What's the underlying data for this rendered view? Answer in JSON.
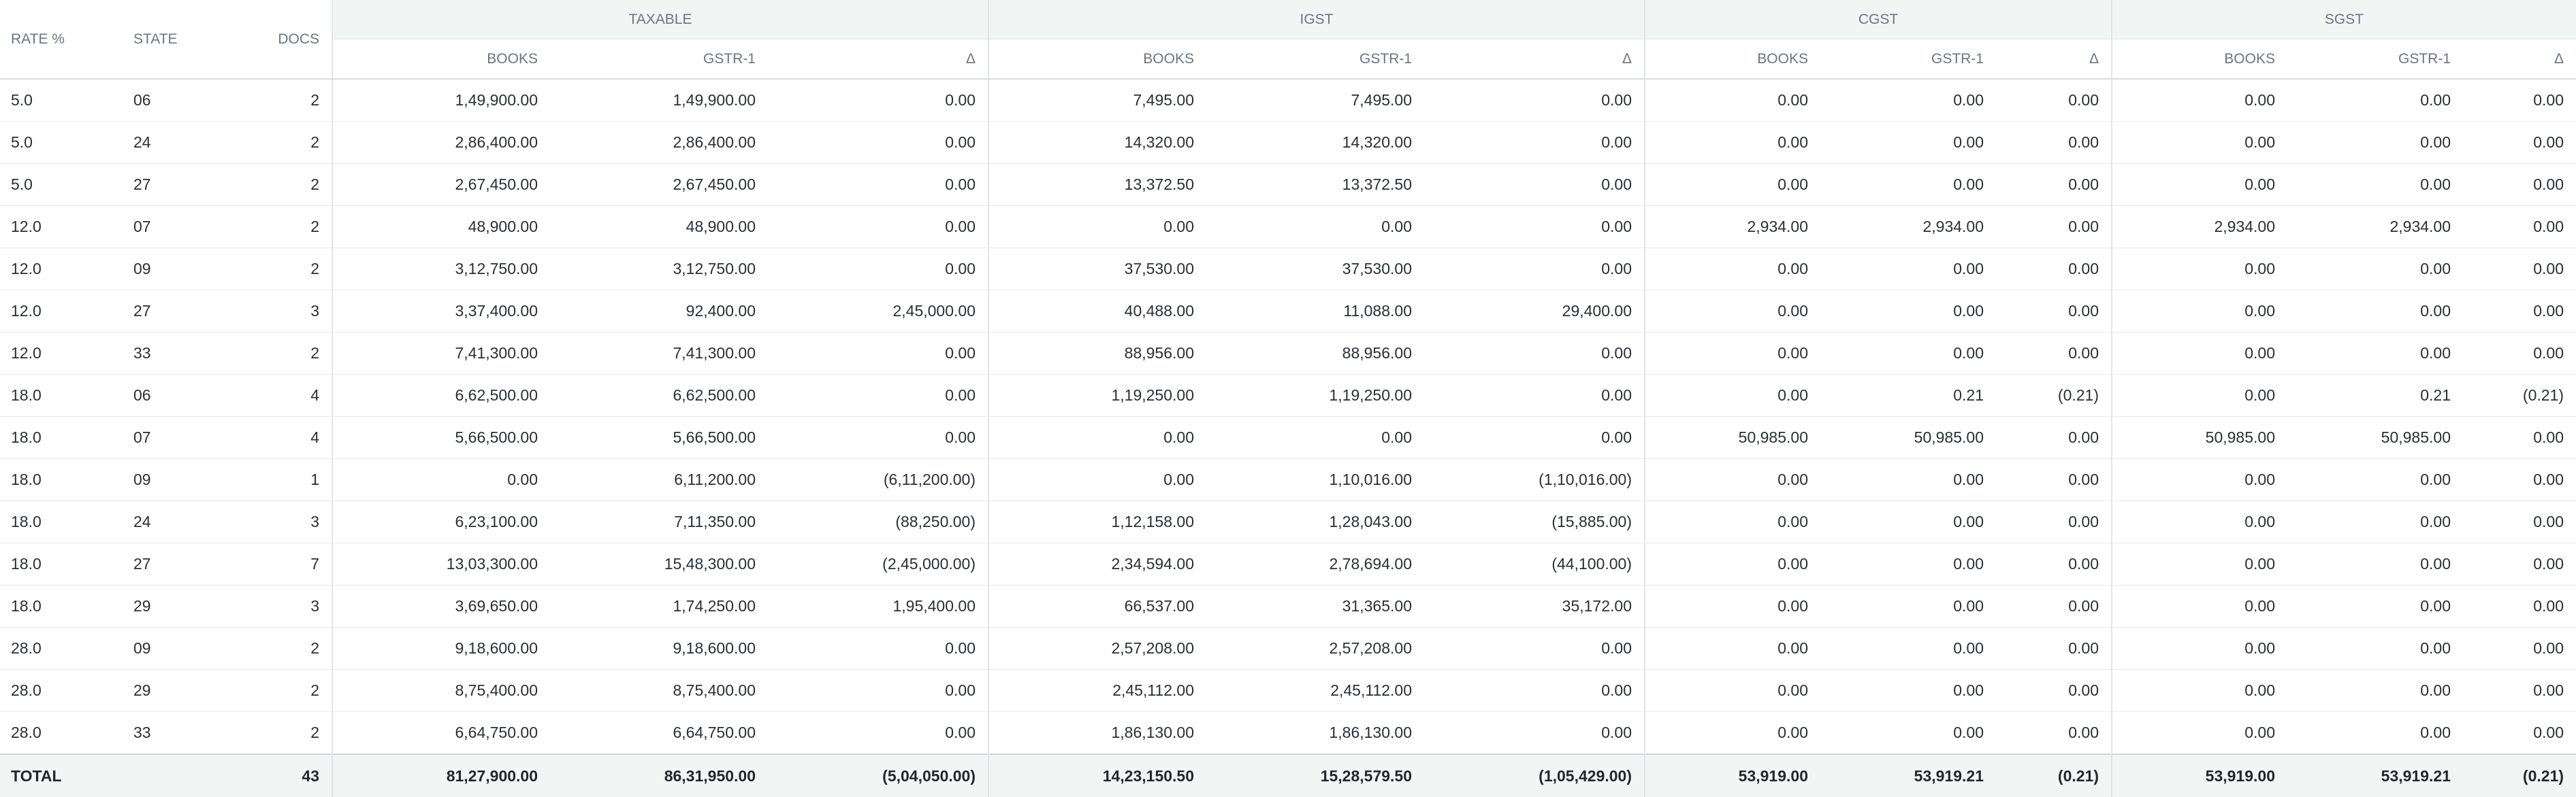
{
  "columns": {
    "rate": "RATE %",
    "state": "STATE",
    "docs": "DOCS",
    "groups": [
      "TAXABLE",
      "IGST",
      "CGST",
      "SGST"
    ],
    "sub": [
      "BOOKS",
      "GSTR-1",
      "Δ"
    ]
  },
  "rows": [
    [
      "5.0",
      "06",
      "2",
      "1,49,900.00",
      "1,49,900.00",
      "0.00",
      "7,495.00",
      "7,495.00",
      "0.00",
      "0.00",
      "0.00",
      "0.00",
      "0.00",
      "0.00",
      "0.00"
    ],
    [
      "5.0",
      "24",
      "2",
      "2,86,400.00",
      "2,86,400.00",
      "0.00",
      "14,320.00",
      "14,320.00",
      "0.00",
      "0.00",
      "0.00",
      "0.00",
      "0.00",
      "0.00",
      "0.00"
    ],
    [
      "5.0",
      "27",
      "2",
      "2,67,450.00",
      "2,67,450.00",
      "0.00",
      "13,372.50",
      "13,372.50",
      "0.00",
      "0.00",
      "0.00",
      "0.00",
      "0.00",
      "0.00",
      "0.00"
    ],
    [
      "12.0",
      "07",
      "2",
      "48,900.00",
      "48,900.00",
      "0.00",
      "0.00",
      "0.00",
      "0.00",
      "2,934.00",
      "2,934.00",
      "0.00",
      "2,934.00",
      "2,934.00",
      "0.00"
    ],
    [
      "12.0",
      "09",
      "2",
      "3,12,750.00",
      "3,12,750.00",
      "0.00",
      "37,530.00",
      "37,530.00",
      "0.00",
      "0.00",
      "0.00",
      "0.00",
      "0.00",
      "0.00",
      "0.00"
    ],
    [
      "12.0",
      "27",
      "3",
      "3,37,400.00",
      "92,400.00",
      "2,45,000.00",
      "40,488.00",
      "11,088.00",
      "29,400.00",
      "0.00",
      "0.00",
      "0.00",
      "0.00",
      "0.00",
      "0.00"
    ],
    [
      "12.0",
      "33",
      "2",
      "7,41,300.00",
      "7,41,300.00",
      "0.00",
      "88,956.00",
      "88,956.00",
      "0.00",
      "0.00",
      "0.00",
      "0.00",
      "0.00",
      "0.00",
      "0.00"
    ],
    [
      "18.0",
      "06",
      "4",
      "6,62,500.00",
      "6,62,500.00",
      "0.00",
      "1,19,250.00",
      "1,19,250.00",
      "0.00",
      "0.00",
      "0.21",
      "(0.21)",
      "0.00",
      "0.21",
      "(0.21)"
    ],
    [
      "18.0",
      "07",
      "4",
      "5,66,500.00",
      "5,66,500.00",
      "0.00",
      "0.00",
      "0.00",
      "0.00",
      "50,985.00",
      "50,985.00",
      "0.00",
      "50,985.00",
      "50,985.00",
      "0.00"
    ],
    [
      "18.0",
      "09",
      "1",
      "0.00",
      "6,11,200.00",
      "(6,11,200.00)",
      "0.00",
      "1,10,016.00",
      "(1,10,016.00)",
      "0.00",
      "0.00",
      "0.00",
      "0.00",
      "0.00",
      "0.00"
    ],
    [
      "18.0",
      "24",
      "3",
      "6,23,100.00",
      "7,11,350.00",
      "(88,250.00)",
      "1,12,158.00",
      "1,28,043.00",
      "(15,885.00)",
      "0.00",
      "0.00",
      "0.00",
      "0.00",
      "0.00",
      "0.00"
    ],
    [
      "18.0",
      "27",
      "7",
      "13,03,300.00",
      "15,48,300.00",
      "(2,45,000.00)",
      "2,34,594.00",
      "2,78,694.00",
      "(44,100.00)",
      "0.00",
      "0.00",
      "0.00",
      "0.00",
      "0.00",
      "0.00"
    ],
    [
      "18.0",
      "29",
      "3",
      "3,69,650.00",
      "1,74,250.00",
      "1,95,400.00",
      "66,537.00",
      "31,365.00",
      "35,172.00",
      "0.00",
      "0.00",
      "0.00",
      "0.00",
      "0.00",
      "0.00"
    ],
    [
      "28.0",
      "09",
      "2",
      "9,18,600.00",
      "9,18,600.00",
      "0.00",
      "2,57,208.00",
      "2,57,208.00",
      "0.00",
      "0.00",
      "0.00",
      "0.00",
      "0.00",
      "0.00",
      "0.00"
    ],
    [
      "28.0",
      "29",
      "2",
      "8,75,400.00",
      "8,75,400.00",
      "0.00",
      "2,45,112.00",
      "2,45,112.00",
      "0.00",
      "0.00",
      "0.00",
      "0.00",
      "0.00",
      "0.00",
      "0.00"
    ],
    [
      "28.0",
      "33",
      "2",
      "6,64,750.00",
      "6,64,750.00",
      "0.00",
      "1,86,130.00",
      "1,86,130.00",
      "0.00",
      "0.00",
      "0.00",
      "0.00",
      "0.00",
      "0.00",
      "0.00"
    ]
  ],
  "total": [
    "TOTAL",
    "",
    "43",
    "81,27,900.00",
    "86,31,950.00",
    "(5,04,050.00)",
    "14,23,150.50",
    "15,28,579.50",
    "(1,05,429.00)",
    "53,919.00",
    "53,919.21",
    "(0.21)",
    "53,919.00",
    "53,919.21",
    "(0.21)"
  ]
}
